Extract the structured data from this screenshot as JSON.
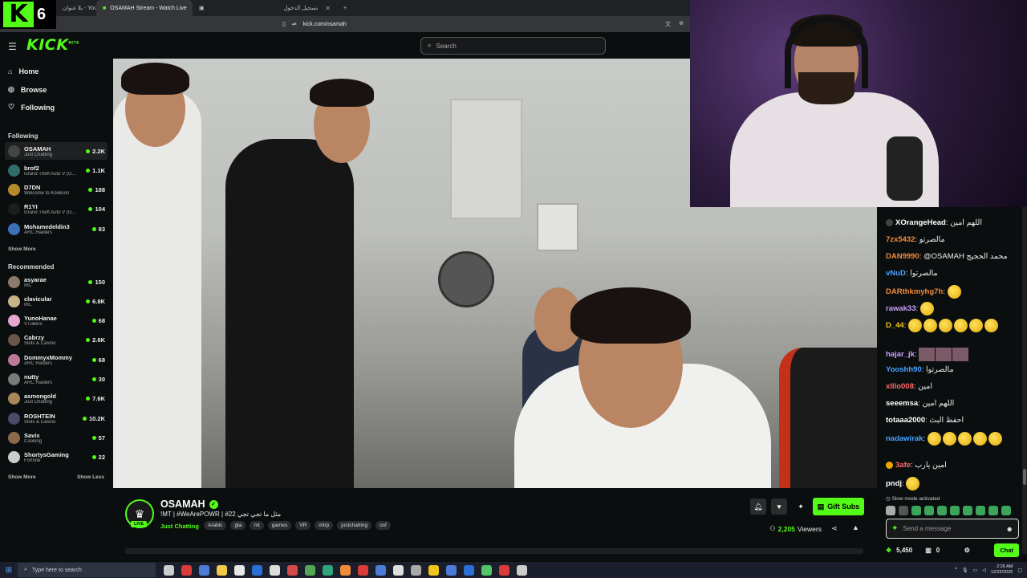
{
  "badge": {
    "number": "6"
  },
  "browser": {
    "tabs": [
      {
        "label": "بلا عنوان - YouTube",
        "active": false
      },
      {
        "label": "OSAMAH Stream - Watch Live",
        "active": true
      },
      {
        "label": "",
        "active": false
      },
      {
        "label": "تسجيل الدخول",
        "active": false
      }
    ],
    "new_tab": "+",
    "url": "kick.com/osamah"
  },
  "header": {
    "logo": "KICK",
    "logo_sup": "BETA",
    "search_placeholder": "Search"
  },
  "sidebar": {
    "nav": [
      {
        "label": "Home",
        "icon": "home-icon"
      },
      {
        "label": "Browse",
        "icon": "compass-icon"
      },
      {
        "label": "Following",
        "icon": "heart-icon"
      }
    ],
    "following_title": "Following",
    "following": [
      {
        "name": "OSAMAH",
        "category": "Just Chatting",
        "count": "2.2K",
        "color": "#444444",
        "active": true
      },
      {
        "name": "brof2",
        "category": "Grand Theft Auto V (G...",
        "count": "1.1K",
        "color": "#2f6f6a"
      },
      {
        "name": "D7DN",
        "category": "Welcome to Kowloon",
        "count": "188",
        "color": "#b48a2c"
      },
      {
        "name": "R1YI",
        "category": "Grand Theft Auto V (G...",
        "count": "104",
        "color": "#1d1d1d"
      },
      {
        "name": "Mohamedeldin3",
        "category": "ARC Raiders",
        "count": "83",
        "color": "#3b6fb6"
      }
    ],
    "show_more_1": "Show More",
    "recommended_title": "Recommended",
    "recommended": [
      {
        "name": "asyarae",
        "category": "IRL",
        "count": "150",
        "color": "#8c7a6b"
      },
      {
        "name": "clavicular",
        "category": "IRL",
        "count": "6.8K",
        "color": "#c9b48a"
      },
      {
        "name": "YunoHanae",
        "category": "VTubers",
        "count": "68",
        "color": "#e6a6d0"
      },
      {
        "name": "Cabrzy",
        "category": "Slots & Casino",
        "count": "2.6K",
        "color": "#6b5448"
      },
      {
        "name": "DommyxMommy",
        "category": "ARC Raiders",
        "count": "68",
        "color": "#b87a9a"
      },
      {
        "name": "nutty",
        "category": "ARC Raiders",
        "count": "30",
        "color": "#7a7a7a"
      },
      {
        "name": "asmongold",
        "category": "Just Chatting",
        "count": "7.6K",
        "color": "#a8865a"
      },
      {
        "name": "ROSHTEIN",
        "category": "Slots & Casino",
        "count": "10.2K",
        "color": "#4a4a6a"
      },
      {
        "name": "Savix",
        "category": "Cooking",
        "count": "57",
        "color": "#8a6a4a"
      },
      {
        "name": "ShortysGaming",
        "category": "Fortnite",
        "count": "22",
        "color": "#cccccc"
      }
    ],
    "show_more_2": "Show More",
    "show_less": "Show Less"
  },
  "stream": {
    "name": "OSAMAH",
    "live": "LIVE",
    "title": "!MT | #WeArePOWR | #22 مثل ما تجي تجي",
    "category": "Just Chatting",
    "tags": [
      "Arabic",
      "gta",
      "mt",
      "games",
      "VR",
      "mtrp",
      "justchatting",
      "osf"
    ],
    "gift_subs": "Gift Subs",
    "viewers_count": "2,205",
    "viewers_label": "Viewers"
  },
  "chat": {
    "messages": [
      {
        "user": "XOrangeHead",
        "color": "#ffffff",
        "text": "اللهم امين",
        "emotes": 0,
        "badge": "#444444"
      },
      {
        "user": "7zx5432",
        "color": "#f08b3c",
        "text": "مالصرتو",
        "emotes": 0
      },
      {
        "user": "DAN9990",
        "color": "#f08b3c",
        "text": "@OSAMAH محمد الحجيج",
        "emotes": 0
      },
      {
        "user": "vNuD",
        "color": "#4aa3ff",
        "text": "مالصرتوا",
        "emotes": 0
      },
      {
        "user": "DARthkmyhg7h",
        "color": "#f08b3c",
        "text": "",
        "emotes": 1
      },
      {
        "user": "rawak33",
        "color": "#c9a0ff",
        "text": "",
        "emotes": 1
      },
      {
        "user": "D_44",
        "color": "#f0c419",
        "text": "",
        "emotes": 6
      },
      {
        "user": "hajar_jk",
        "color": "#c9a0ff",
        "text": "",
        "emotes": 0,
        "squares": 3
      },
      {
        "user": "Yooshh90",
        "color": "#4aa3ff",
        "text": "مالصرتوا",
        "emotes": 0
      },
      {
        "user": "xlllo008",
        "color": "#ff6b6b",
        "text": "امين",
        "emotes": 0
      },
      {
        "user": "seeemsa",
        "color": "#ffffff",
        "text": "اللهم امين",
        "emotes": 0
      },
      {
        "user": "totaaa2000",
        "color": "#ffffff",
        "text": "احفظ البث",
        "emotes": 0
      },
      {
        "user": "nadawirak",
        "color": "#4aa3ff",
        "text": "",
        "emotes": 5
      },
      {
        "user": "3afe",
        "color": "#ff6b6b",
        "text": "امين يارب",
        "emotes": 0,
        "badge": "#f0a500"
      },
      {
        "user": "pndj",
        "color": "#ffffff",
        "text": "",
        "emotes": 1
      }
    ],
    "slow_mode": "Slow mode activated",
    "input_placeholder": "Send a message",
    "points": "5,450",
    "other_count": "0",
    "send_label": "Chat"
  },
  "taskbar": {
    "search_placeholder": "Type here to search",
    "time": "2:26 AM",
    "date": "12/22/2025",
    "app_colors": [
      "#cccccc",
      "#d93b3b",
      "#4d7bd8",
      "#f0c94a",
      "#e6e6e6",
      "#2a6fd6",
      "#dddddd",
      "#d34b4b",
      "#53a653",
      "#2fa37a",
      "#f08b3c",
      "#d93b3b",
      "#4d7bd8",
      "#dddddd",
      "#a8a8a8",
      "#f0c419",
      "#4d7bd8",
      "#2a6fd6",
      "#53c468",
      "#d93b3b",
      "#cccccc"
    ]
  }
}
